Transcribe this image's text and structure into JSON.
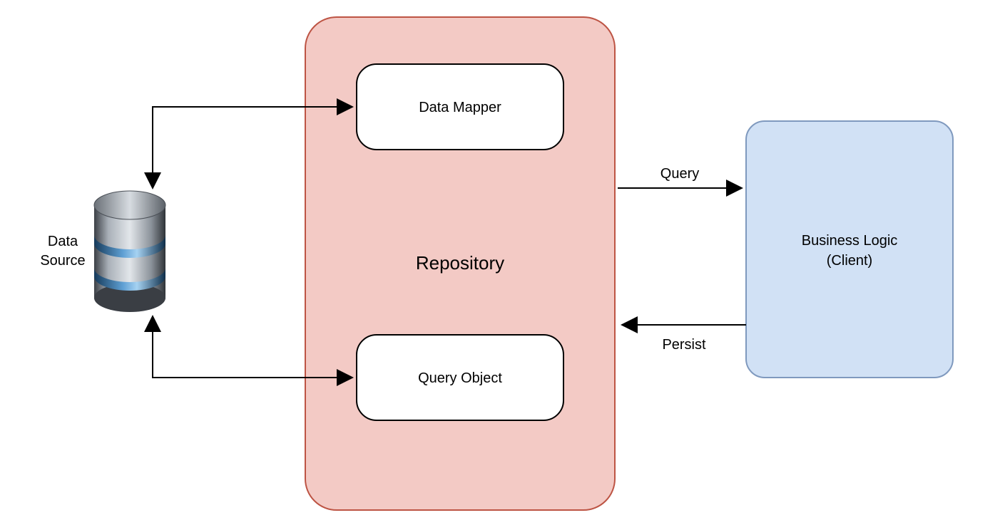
{
  "nodes": {
    "dataSource": {
      "label1": "Data",
      "label2": "Source"
    },
    "repository": {
      "label": "Repository"
    },
    "dataMapper": {
      "label": "Data Mapper"
    },
    "queryObject": {
      "label": "Query Object"
    },
    "businessLogic": {
      "label1": "Business Logic",
      "label2": "(Client)"
    }
  },
  "edges": {
    "query": {
      "label": "Query"
    },
    "persist": {
      "label": "Persist"
    }
  },
  "colors": {
    "repositoryFill": "#F3CAC5",
    "repositoryStroke": "#BD5444",
    "clientFill": "#D1E1F5",
    "clientStroke": "#7F99BE",
    "innerStroke": "#000000",
    "arrow": "#000000"
  }
}
